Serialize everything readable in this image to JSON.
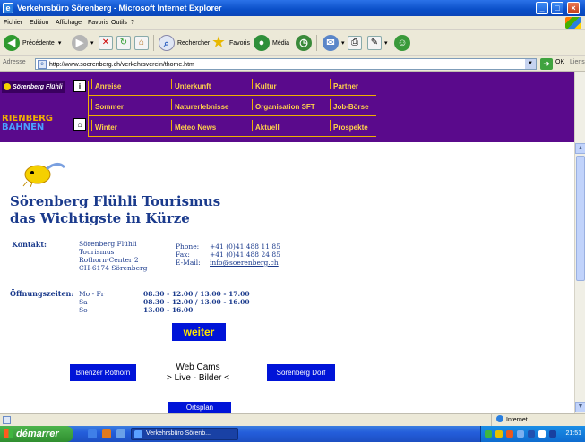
{
  "window": {
    "title": "Verkehrsbüro Sörenberg - Microsoft Internet Explorer",
    "buttons": {
      "minimize": "_",
      "maximize": "□",
      "close": "×"
    }
  },
  "menubar": [
    "Fichier",
    "Edition",
    "Affichage",
    "Favoris",
    "Outils",
    "?"
  ],
  "toolbar": {
    "back": "Précédente",
    "search": "Rechercher",
    "favorites": "Favoris",
    "media": "Média"
  },
  "address": {
    "label": "Adresse",
    "url": "http://www.soerenberg.ch/verkehrsverein/thome.htm",
    "go": "OK",
    "links": "Liens"
  },
  "site": {
    "brand_top": "Sörenberg Flühli",
    "brand_bottom_1": "RIENBERG",
    "brand_bottom_2": "BAHNEN",
    "info_icon": "i",
    "nav": [
      {
        "label": "Anreise"
      },
      {
        "label": "Unterkunft"
      },
      {
        "label": "Kultur"
      },
      {
        "label": "Partner"
      },
      {
        "label": "Sommer"
      },
      {
        "label": "Naturerlebnisse"
      },
      {
        "label": "Organisation SFT"
      },
      {
        "label": "Job-Börse"
      },
      {
        "label": "Winter"
      },
      {
        "label": "Meteo News"
      },
      {
        "label": "Aktuell"
      },
      {
        "label": "Prospekte"
      }
    ],
    "title_line1": "Sörenberg Flühli Tourismus",
    "title_line2": "das Wichtigste in Kürze",
    "kontakt": {
      "label": "Kontakt:",
      "address": [
        "Sörenberg Flühli",
        "Tourismus",
        "Rothorn-Center 2",
        "CH-6174 Sörenberg"
      ],
      "phone_label": "Phone:",
      "phone": "+41 (0)41 488 11 85",
      "fax_label": "Fax:",
      "fax": "+41 (0)41 488 24 85",
      "email_label": "E-Mail:",
      "email": "info@soerenberg.ch"
    },
    "oeffnungszeiten": {
      "label": "Öffnungszeiten:",
      "rows": [
        {
          "day": "Mo - Fr",
          "hours": "08.30 - 12.00 / 13.00 - 17.00"
        },
        {
          "day": "Sa",
          "hours": "08.30 - 12.00 / 13.00 - 16.00"
        },
        {
          "day": "So",
          "hours": "13.00 - 16.00"
        }
      ]
    },
    "weiter": "weiter",
    "brienzer_rothorn": "Brienzer Rothorn",
    "webcams_line1": "Web Cams",
    "webcams_line2": "> Live - Bilder <",
    "soerenberg_dorf": "Sörenberg Dorf",
    "ortsplan": "Ortsplan"
  },
  "statusbar": {
    "zone": "Internet"
  },
  "taskbar": {
    "start": "démarrer",
    "task": "Verkehrsbüro Sörenb...",
    "clock": "21:51"
  }
}
